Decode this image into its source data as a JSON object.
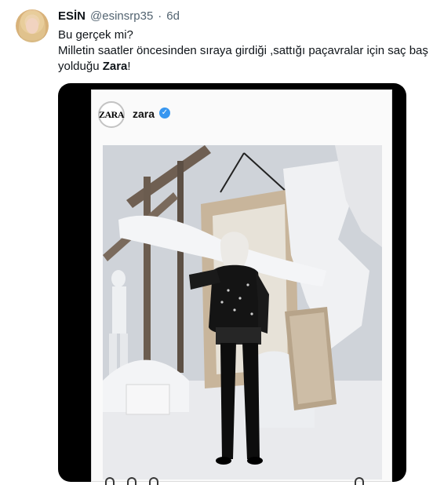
{
  "author": {
    "name": "ESİN",
    "handle": "@esinsrp35",
    "separator": "·",
    "time": "6d"
  },
  "tweet": {
    "line1": "Bu gerçek mi?",
    "line2": "Milletin saatler öncesinden sıraya girdiği ,sattığı paçavralar için saç baş",
    "line3_prefix": "yolduğu ",
    "line3_bold": "Zara",
    "line3_suffix": "!"
  },
  "embedded_post": {
    "logo_text": "ZARA",
    "account_name": "zara",
    "verified_icon": "verified-badge-icon",
    "verified_glyph": "✓"
  },
  "colors": {
    "text": "#0f1419",
    "secondary": "#536471",
    "verified": "#3897f0"
  }
}
